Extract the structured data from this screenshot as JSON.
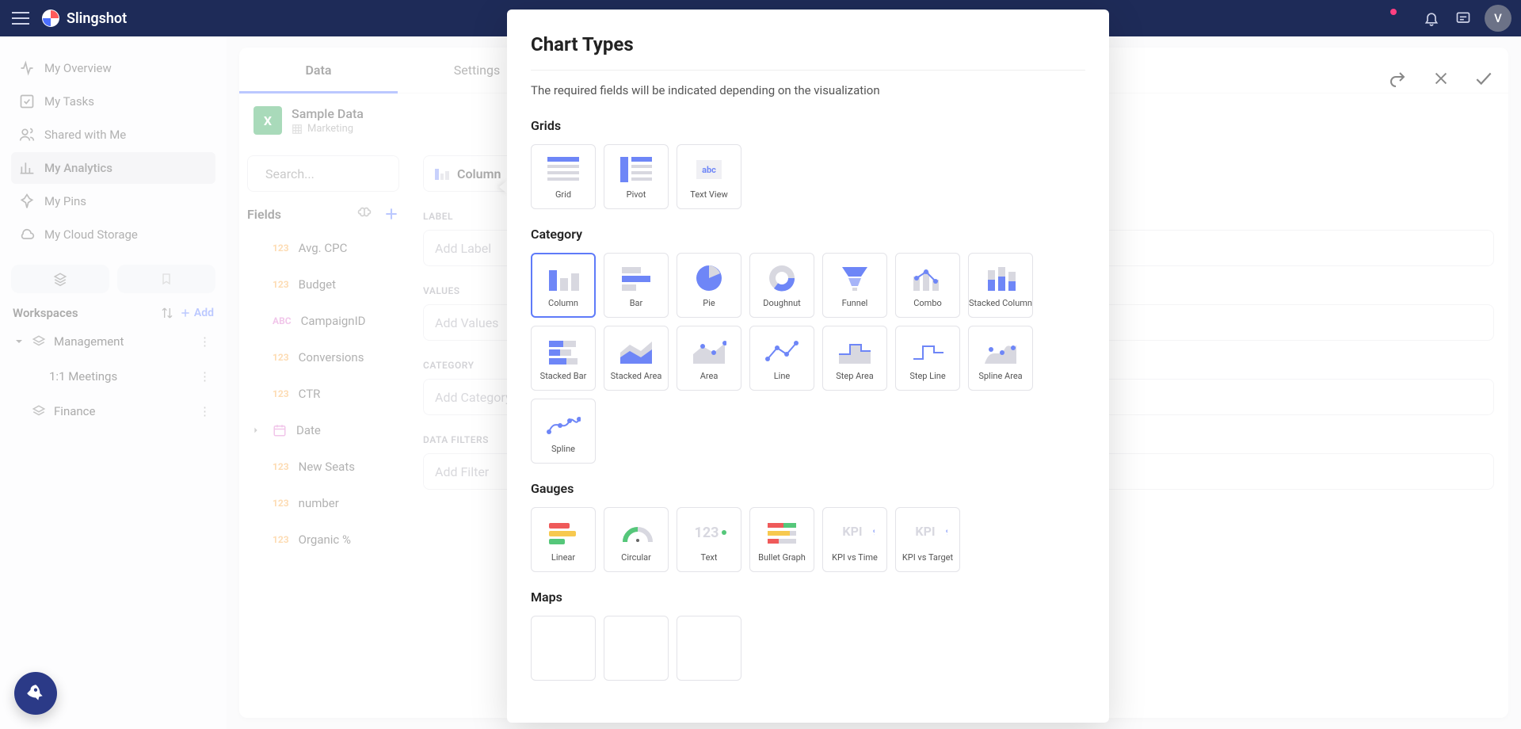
{
  "app": {
    "name": "Slingshot",
    "avatar_initial": "V"
  },
  "sidebar": {
    "items": [
      {
        "label": "My Overview"
      },
      {
        "label": "My Tasks"
      },
      {
        "label": "Shared with Me"
      },
      {
        "label": "My Analytics"
      },
      {
        "label": "My Pins"
      },
      {
        "label": "My Cloud Storage"
      }
    ],
    "workspaces_label": "Workspaces",
    "add_label": "Add",
    "ws": [
      {
        "label": "Management",
        "sub": [
          {
            "label": "1:1 Meetings"
          }
        ]
      },
      {
        "label": "Finance"
      }
    ]
  },
  "editor": {
    "tabs": [
      "Data",
      "Settings"
    ],
    "data_source": {
      "title": "Sample Data",
      "sheet": "Marketing"
    },
    "search_placeholder": "Search...",
    "chart_selector": "Column",
    "fields_label": "Fields",
    "fields": [
      {
        "type": "123",
        "name": "Avg. CPC"
      },
      {
        "type": "123",
        "name": "Budget"
      },
      {
        "type": "ABC",
        "name": "CampaignID"
      },
      {
        "type": "123",
        "name": "Conversions"
      },
      {
        "type": "123",
        "name": "CTR"
      },
      {
        "type": "DATE",
        "name": "Date"
      },
      {
        "type": "123",
        "name": "New Seats"
      },
      {
        "type": "123",
        "name": "number"
      },
      {
        "type": "123",
        "name": "Organic %"
      }
    ],
    "sections": {
      "label": {
        "title": "LABEL",
        "placeholder": "Add Label"
      },
      "values": {
        "title": "VALUES",
        "placeholder": "Add Values"
      },
      "category": {
        "title": "CATEGORY",
        "placeholder": "Add Category"
      },
      "filters": {
        "title": "DATA FILTERS",
        "placeholder": "Add Filter"
      }
    }
  },
  "modal": {
    "title": "Chart Types",
    "subtitle": "The required fields will be indicated depending on the visualization",
    "groups": [
      {
        "title": "Grids",
        "items": [
          {
            "label": "Grid",
            "icon": "grid"
          },
          {
            "label": "Pivot",
            "icon": "pivot"
          },
          {
            "label": "Text View",
            "icon": "textview"
          }
        ]
      },
      {
        "title": "Category",
        "items": [
          {
            "label": "Column",
            "icon": "column",
            "selected": true
          },
          {
            "label": "Bar",
            "icon": "bar"
          },
          {
            "label": "Pie",
            "icon": "pie"
          },
          {
            "label": "Doughnut",
            "icon": "doughnut"
          },
          {
            "label": "Funnel",
            "icon": "funnel"
          },
          {
            "label": "Combo",
            "icon": "combo"
          },
          {
            "label": "Stacked Column",
            "icon": "stackedcol"
          },
          {
            "label": "Stacked Bar",
            "icon": "stackedbar"
          },
          {
            "label": "Stacked Area",
            "icon": "stackedarea"
          },
          {
            "label": "Area",
            "icon": "area"
          },
          {
            "label": "Line",
            "icon": "line"
          },
          {
            "label": "Step Area",
            "icon": "steparea"
          },
          {
            "label": "Step Line",
            "icon": "stepline"
          },
          {
            "label": "Spline Area",
            "icon": "splinearea"
          },
          {
            "label": "Spline",
            "icon": "spline"
          }
        ]
      },
      {
        "title": "Gauges",
        "items": [
          {
            "label": "Linear",
            "icon": "linear"
          },
          {
            "label": "Circular",
            "icon": "circular"
          },
          {
            "label": "Text",
            "icon": "textgauge"
          },
          {
            "label": "Bullet Graph",
            "icon": "bullet"
          },
          {
            "label": "KPI vs Time",
            "icon": "kpitime"
          },
          {
            "label": "KPI vs Target",
            "icon": "kpitarget"
          }
        ]
      },
      {
        "title": "Maps",
        "items": [
          {
            "label": "",
            "icon": "blank"
          },
          {
            "label": "",
            "icon": "blank"
          },
          {
            "label": "",
            "icon": "blank"
          }
        ]
      }
    ]
  }
}
